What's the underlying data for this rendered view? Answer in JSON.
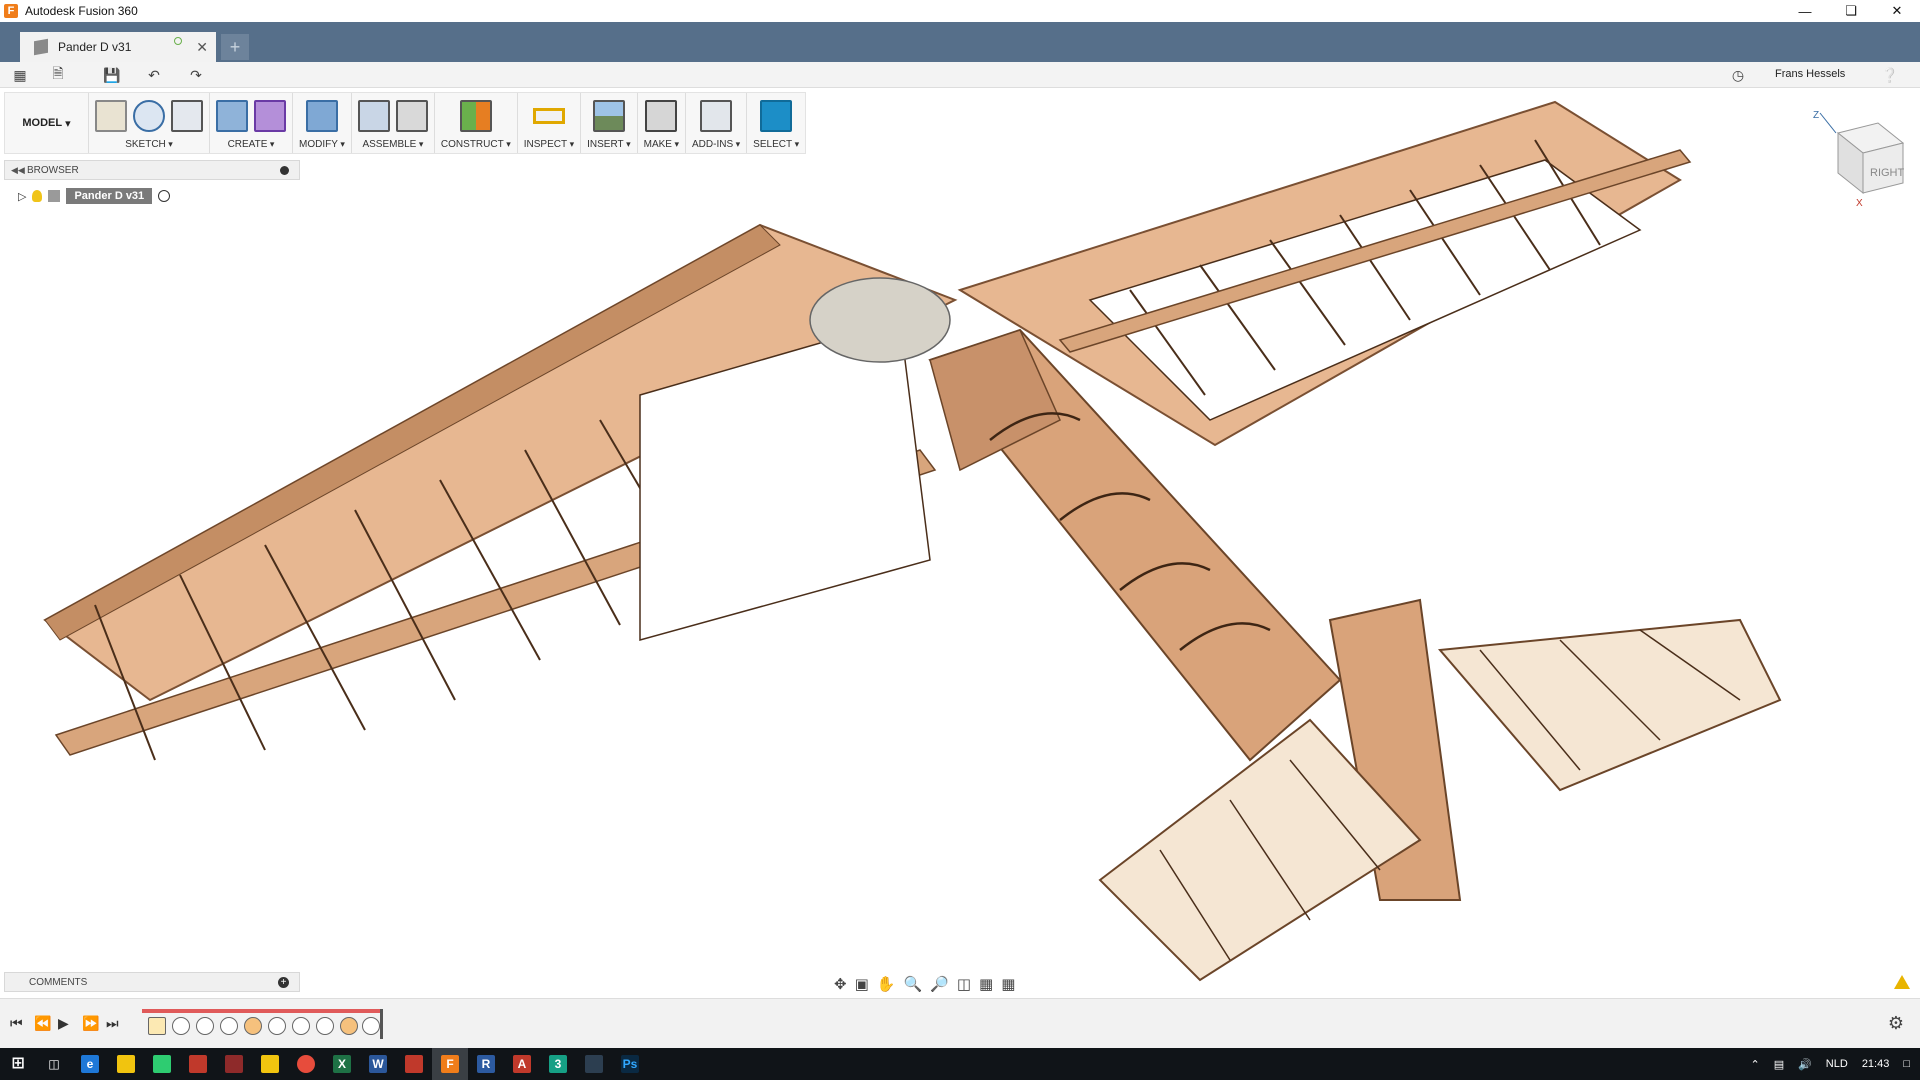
{
  "window": {
    "title": "Autodesk Fusion 360",
    "app_icon_letter": "F"
  },
  "document_tab": {
    "label": "Pander D v31",
    "new_tab_symbol": "+"
  },
  "quick_access": {
    "user_name": "Frans Hessels"
  },
  "toolbar": {
    "workspace": "MODEL",
    "groups": [
      {
        "label": "SKETCH"
      },
      {
        "label": "CREATE"
      },
      {
        "label": "MODIFY"
      },
      {
        "label": "ASSEMBLE"
      },
      {
        "label": "CONSTRUCT"
      },
      {
        "label": "INSPECT"
      },
      {
        "label": "INSERT"
      },
      {
        "label": "MAKE"
      },
      {
        "label": "ADD-INS"
      },
      {
        "label": "SELECT"
      }
    ]
  },
  "browser": {
    "title": "BROWSER",
    "root_component": "Pander D v31"
  },
  "comments": {
    "title": "COMMENTS"
  },
  "viewcube": {
    "face_label": "RIGHT",
    "axis_z": "Z",
    "axis_x": "X"
  },
  "taskbar": {
    "language": "NLD",
    "clock": "21:43"
  },
  "colors": {
    "tab_bar": "#566f8a",
    "wood": "#d9a37a",
    "wood_dark": "#b07a52",
    "select_active": "#1c8ec7",
    "timeline_progress": "#e05a5a"
  }
}
